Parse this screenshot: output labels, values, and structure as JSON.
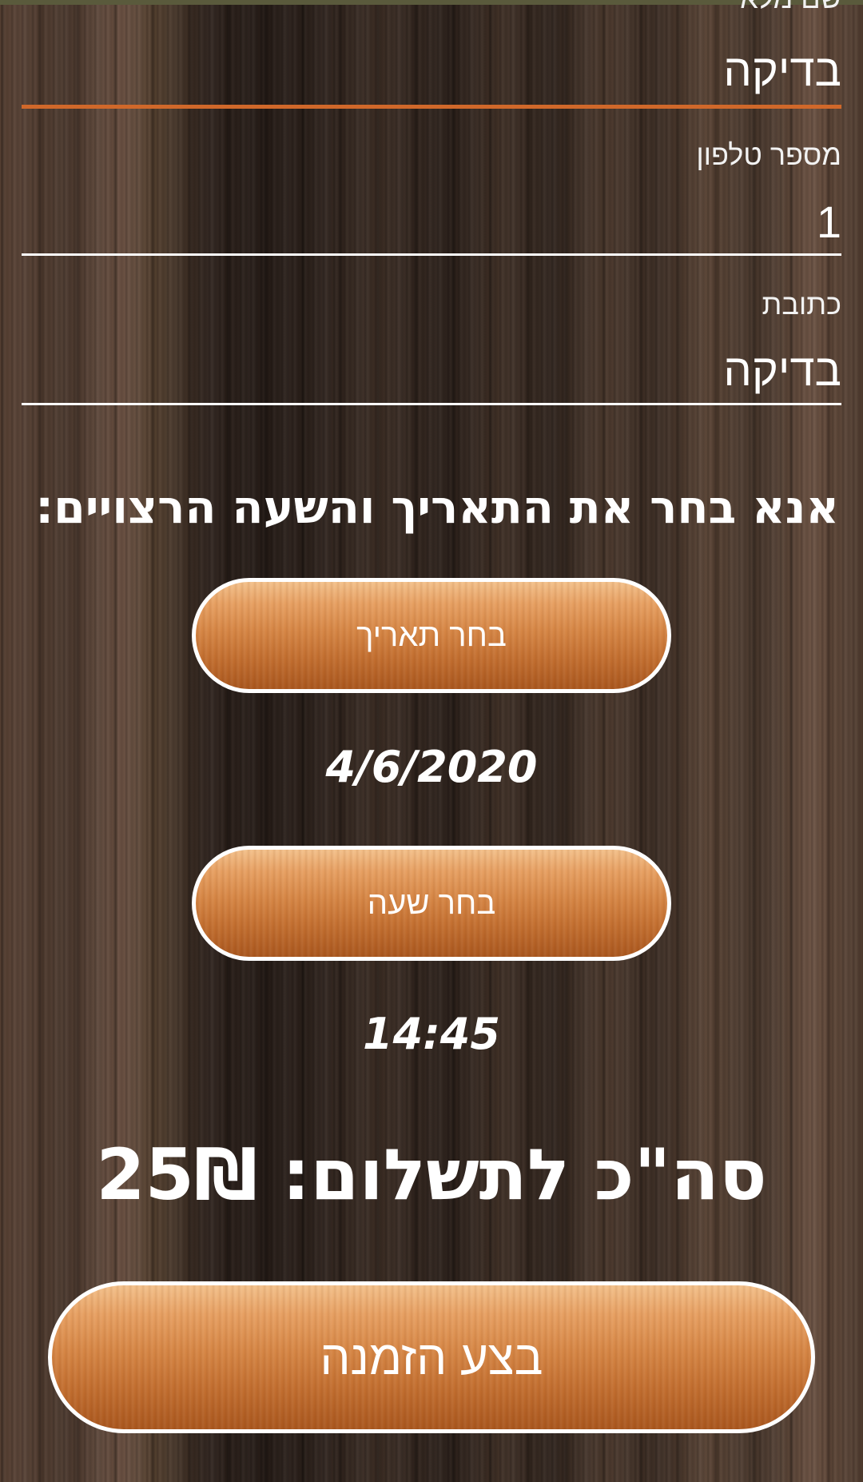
{
  "form": {
    "name_label": "שם מלא",
    "name_value": "בדיקה",
    "phone_label": "מספר טלפון",
    "phone_value": "1",
    "address_label": "כתובת",
    "address_value": "בדיקה"
  },
  "booking": {
    "heading": "אנא בחר את התאריך והשעה הרצויים:",
    "pick_date_label": "בחר תאריך",
    "selected_date": "4/6/2020",
    "pick_time_label": "בחר שעה",
    "selected_time": "14:45",
    "total_text": "סה\"כ לתשלום: 25₪",
    "order_button_label": "בצע הזמנה"
  },
  "colors": {
    "accent": "#d0682a",
    "button_top": "#f3c08a",
    "button_bottom": "#a9561d",
    "text": "#ffffff"
  }
}
